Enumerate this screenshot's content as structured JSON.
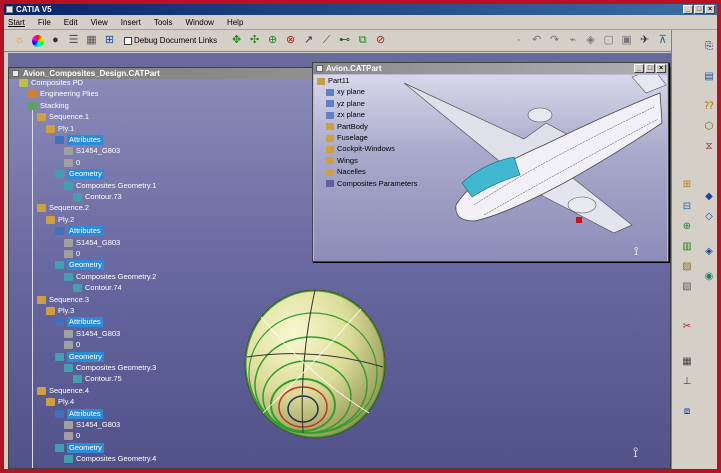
{
  "app": {
    "title": "CATIA V5"
  },
  "menu": [
    "Start",
    "File",
    "Edit",
    "View",
    "Insert",
    "Tools",
    "Window",
    "Help"
  ],
  "toolbar": {
    "debug_label": "Debug Document Links"
  },
  "main_window": {
    "title": "Avion_Composites_Design.CATPart"
  },
  "tree": [
    {
      "label": "Composites PD",
      "icon": "composites-icon"
    },
    {
      "label": "Engineering Plies",
      "icon": "plies-icon"
    },
    {
      "label": "Stacking",
      "icon": "stacking-icon"
    },
    {
      "label": "Sequence.1",
      "icon": "sequence-icon"
    },
    {
      "label": "Ply.1",
      "icon": "ply-icon"
    },
    {
      "label": "Attributes",
      "icon": "attributes-icon"
    },
    {
      "label": "S1454_G803",
      "icon": "material-icon"
    },
    {
      "label": "0",
      "icon": "angle-icon"
    },
    {
      "label": "Geometry",
      "icon": "geometry-icon"
    },
    {
      "label": "Composites Geometry.1",
      "icon": "geometry-icon"
    },
    {
      "label": "Contour.73",
      "icon": "contour-icon"
    },
    {
      "label": "Sequence.2",
      "icon": "sequence-icon"
    },
    {
      "label": "Ply.2",
      "icon": "ply-icon"
    },
    {
      "label": "Attributes",
      "icon": "attributes-icon"
    },
    {
      "label": "S1454_G803",
      "icon": "material-icon"
    },
    {
      "label": "0",
      "icon": "angle-icon"
    },
    {
      "label": "Geometry",
      "icon": "geometry-icon"
    },
    {
      "label": "Composites Geometry.2",
      "icon": "geometry-icon"
    },
    {
      "label": "Contour.74",
      "icon": "contour-icon"
    },
    {
      "label": "Sequence.3",
      "icon": "sequence-icon"
    },
    {
      "label": "Ply.3",
      "icon": "ply-icon"
    },
    {
      "label": "Attributes",
      "icon": "attributes-icon"
    },
    {
      "label": "S1454_G803",
      "icon": "material-icon"
    },
    {
      "label": "0",
      "icon": "angle-icon"
    },
    {
      "label": "Geometry",
      "icon": "geometry-icon"
    },
    {
      "label": "Composites Geometry.3",
      "icon": "geometry-icon"
    },
    {
      "label": "Contour.75",
      "icon": "contour-icon"
    },
    {
      "label": "Sequence.4",
      "icon": "sequence-icon"
    },
    {
      "label": "Ply.4",
      "icon": "ply-icon"
    },
    {
      "label": "Attributes",
      "icon": "attributes-icon"
    },
    {
      "label": "S1454_G803",
      "icon": "material-icon"
    },
    {
      "label": "0",
      "icon": "angle-icon"
    },
    {
      "label": "Geometry",
      "icon": "geometry-icon"
    },
    {
      "label": "Composites Geometry.4",
      "icon": "geometry-icon"
    }
  ],
  "part_window": {
    "title": "Avion.CATPart",
    "tree": [
      {
        "label": "Part11",
        "icon": "part-icon"
      },
      {
        "label": "xy plane",
        "icon": "plane-icon"
      },
      {
        "label": "yz plane",
        "icon": "plane-icon"
      },
      {
        "label": "zx plane",
        "icon": "plane-icon"
      },
      {
        "label": "PartBody",
        "icon": "body-icon"
      },
      {
        "label": "Fuselage",
        "icon": "body-icon"
      },
      {
        "label": "Cockpit-Windows",
        "icon": "body-icon"
      },
      {
        "label": "Wings",
        "icon": "body-icon"
      },
      {
        "label": "Nacelles",
        "icon": "body-icon"
      },
      {
        "label": "Composites Parameters",
        "icon": "parameters-icon"
      }
    ]
  },
  "colors": {
    "frame": "#b51323",
    "title_active": "#0a246a",
    "tree_highlight": "#2a8cd6",
    "viewport": "#6868a0"
  }
}
